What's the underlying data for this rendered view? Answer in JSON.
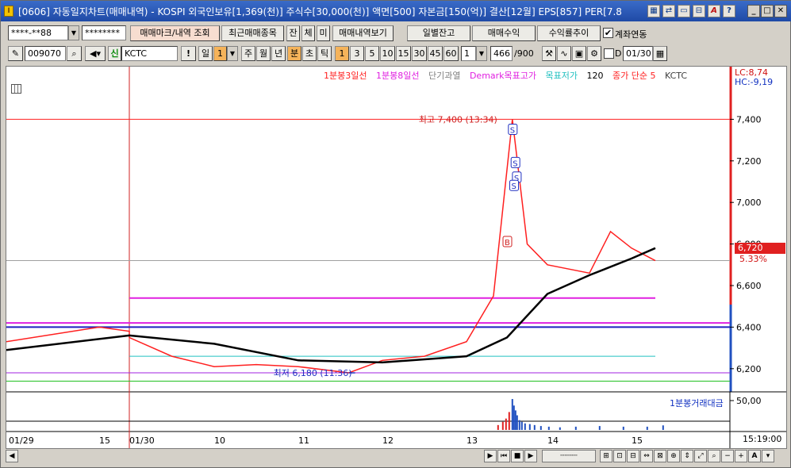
{
  "window": {
    "title": "[0606] 자동일지차트(매매내역) - KOSPI 외국인보유[1,369(천)] 주식수[30,000(천)] 액면[500] 자본금[150(억)] 결산[12월] EPS[857] PER[7.8",
    "icon_letter": "I",
    "titlebar_icons": [
      "chart-icon",
      "swap-icon",
      "window-icon",
      "link-icon",
      "font-a-icon",
      "help-icon"
    ],
    "help_label": "?",
    "font_label": "A"
  },
  "toolbar1": {
    "account_value": "****-**88",
    "password_value": "********",
    "trade_mark_button": "매매마크/내역 조회",
    "recent_trade_button": "최근매매종목",
    "jan_button": "잔",
    "che_button": "체",
    "mi_button": "미",
    "trade_view_button": "매매내역보기",
    "daily_balance_button": "일별잔고",
    "trade_profit_button": "매매수익",
    "return_trend_button": "수익률추이",
    "account_link_label": "계좌연동",
    "account_link_checked": "✔"
  },
  "toolbar2": {
    "code_value": "009070",
    "new_label": "신",
    "stock_name": "KCTC",
    "excl_label": "!",
    "day_label": "일",
    "day_num": "1",
    "periods": [
      "주",
      "월",
      "년",
      "분",
      "초",
      "틱"
    ],
    "selected_period": "분",
    "minutes": [
      "1",
      "3",
      "5",
      "10",
      "15",
      "30",
      "45",
      "60"
    ],
    "selected_minute": "1",
    "count_value": "1",
    "range_value": "466",
    "range_total": "/900",
    "d_label": "D",
    "date_value": "01/30"
  },
  "chart": {
    "legend": [
      {
        "text": "1분봉3일선",
        "color": "#ff2020"
      },
      {
        "text": "1분봉8일선",
        "color": "#e020e0"
      },
      {
        "text": "단기과열",
        "color": "#808080"
      },
      {
        "text": "Demark목표고가",
        "color": "#e020e0"
      },
      {
        "text": "목표저가",
        "color": "#20c0c0"
      },
      {
        "text": "120",
        "color": "#000000"
      },
      {
        "text": "종가 단순 5",
        "color": "#ff2020"
      },
      {
        "text": "KCTC",
        "color": "#404040"
      }
    ],
    "lc": "LC:8,74",
    "hc": "HC:-9,19",
    "current_price": "6,720",
    "change_pct": "5.33%",
    "high_annotation": "최고 7,400 (13:34)",
    "low_annotation": "최저 6,180 (11:36)",
    "buy_marker": "B",
    "sell_marker": "S",
    "volume_legend": "1분봉거래대금",
    "volume_axis_label": "50,00",
    "time_readout": "15:19:00",
    "date_labels": [
      "01/29",
      "15",
      "01/30",
      "10",
      "11",
      "12",
      "13",
      "14",
      "15"
    ]
  },
  "chart_data": {
    "type": "line",
    "title": "",
    "xlabel": "",
    "ylabel": "",
    "y_ticks": [
      6200,
      6400,
      6600,
      6800,
      7000,
      7200,
      7400
    ],
    "ylim": [
      6100,
      7600
    ],
    "x_labels": [
      "01/29",
      "15",
      "01/30",
      "10",
      "11",
      "12",
      "13",
      "14",
      "15"
    ],
    "series": [
      {
        "name": "KCTC",
        "color": "#ff2020",
        "x": [
          "01/29 14:30",
          "01/29 15:00",
          "01/29 15:20",
          "01/30 09:00",
          "01/30 09:30",
          "01/30 10:00",
          "01/30 10:30",
          "01/30 11:00",
          "01/30 11:36",
          "01/30 12:00",
          "01/30 12:30",
          "01/30 13:00",
          "01/30 13:20",
          "01/30 13:34",
          "01/30 13:45",
          "01/30 14:00",
          "01/30 14:30",
          "01/30 14:45",
          "01/30 15:00",
          "01/30 15:19"
        ],
        "values": [
          6330,
          6400,
          6380,
          6350,
          6260,
          6210,
          6220,
          6210,
          6180,
          6240,
          6260,
          6330,
          6550,
          7400,
          6800,
          6700,
          6660,
          6860,
          6780,
          6720
        ]
      },
      {
        "name": "120",
        "color": "#000000",
        "x": [
          "01/29 14:30",
          "01/29 15:20",
          "01/30 10:00",
          "01/30 11:00",
          "01/30 12:00",
          "01/30 13:00",
          "01/30 13:30",
          "01/30 14:00",
          "01/30 14:30",
          "01/30 15:00",
          "01/30 15:19"
        ],
        "values": [
          6290,
          6360,
          6320,
          6240,
          6230,
          6260,
          6350,
          6560,
          6650,
          6730,
          6780
        ]
      }
    ],
    "horizontal_lines": [
      {
        "value": 7400,
        "color": "#ff2020"
      },
      {
        "value": 6720,
        "color": "#a0a0a0"
      },
      {
        "value": 6540,
        "color": "#e020e0"
      },
      {
        "value": 6420,
        "color": "#e020e0"
      },
      {
        "value": 6400,
        "color": "#2020c0"
      },
      {
        "value": 6260,
        "color": "#20c0c0"
      },
      {
        "value": 6180,
        "color": "#a020e0"
      },
      {
        "value": 6140,
        "color": "#20c020"
      }
    ],
    "markers": [
      {
        "type": "S",
        "time": "01/30 13:34",
        "value": 7350
      },
      {
        "type": "S",
        "time": "01/30 13:36",
        "value": 7190
      },
      {
        "type": "S",
        "time": "01/30 13:37",
        "value": 7120
      },
      {
        "type": "S",
        "time": "01/30 13:35",
        "value": 7080
      },
      {
        "type": "B",
        "time": "01/30 13:30",
        "value": 6810
      }
    ],
    "volume": {
      "name": "1분봉거래대금",
      "peak_time": "01/30 13:34",
      "axis_max": 5000
    },
    "grid": false,
    "legend_position": "top"
  }
}
